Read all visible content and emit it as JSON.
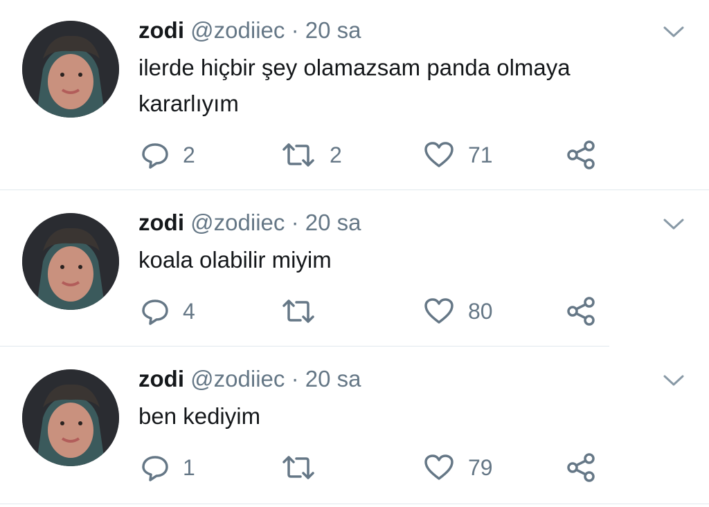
{
  "tweets": [
    {
      "name": "zodi",
      "handle": "@zodiiec",
      "separator": "·",
      "time": "20 sa",
      "text": "ilerde hiçbir şey olamazsam panda olmaya\nkararlıyım",
      "reply_count": "2",
      "retweet_count": "2",
      "like_count": "71"
    },
    {
      "name": "zodi",
      "handle": "@zodiiec",
      "separator": "·",
      "time": "20 sa",
      "text": "koala olabilir miyim",
      "reply_count": "4",
      "retweet_count": "",
      "like_count": "80"
    },
    {
      "name": "zodi",
      "handle": "@zodiiec",
      "separator": "·",
      "time": "20 sa",
      "text": "ben kediyim",
      "reply_count": "1",
      "retweet_count": "",
      "like_count": "79"
    }
  ],
  "icons": {
    "reply": "reply-icon",
    "retweet": "retweet-icon",
    "like": "heart-icon",
    "share": "share-icon",
    "menu": "chevron-down-icon"
  },
  "colors": {
    "name": "#14171a",
    "secondary": "#657786",
    "divider": "#e1e8ed"
  }
}
